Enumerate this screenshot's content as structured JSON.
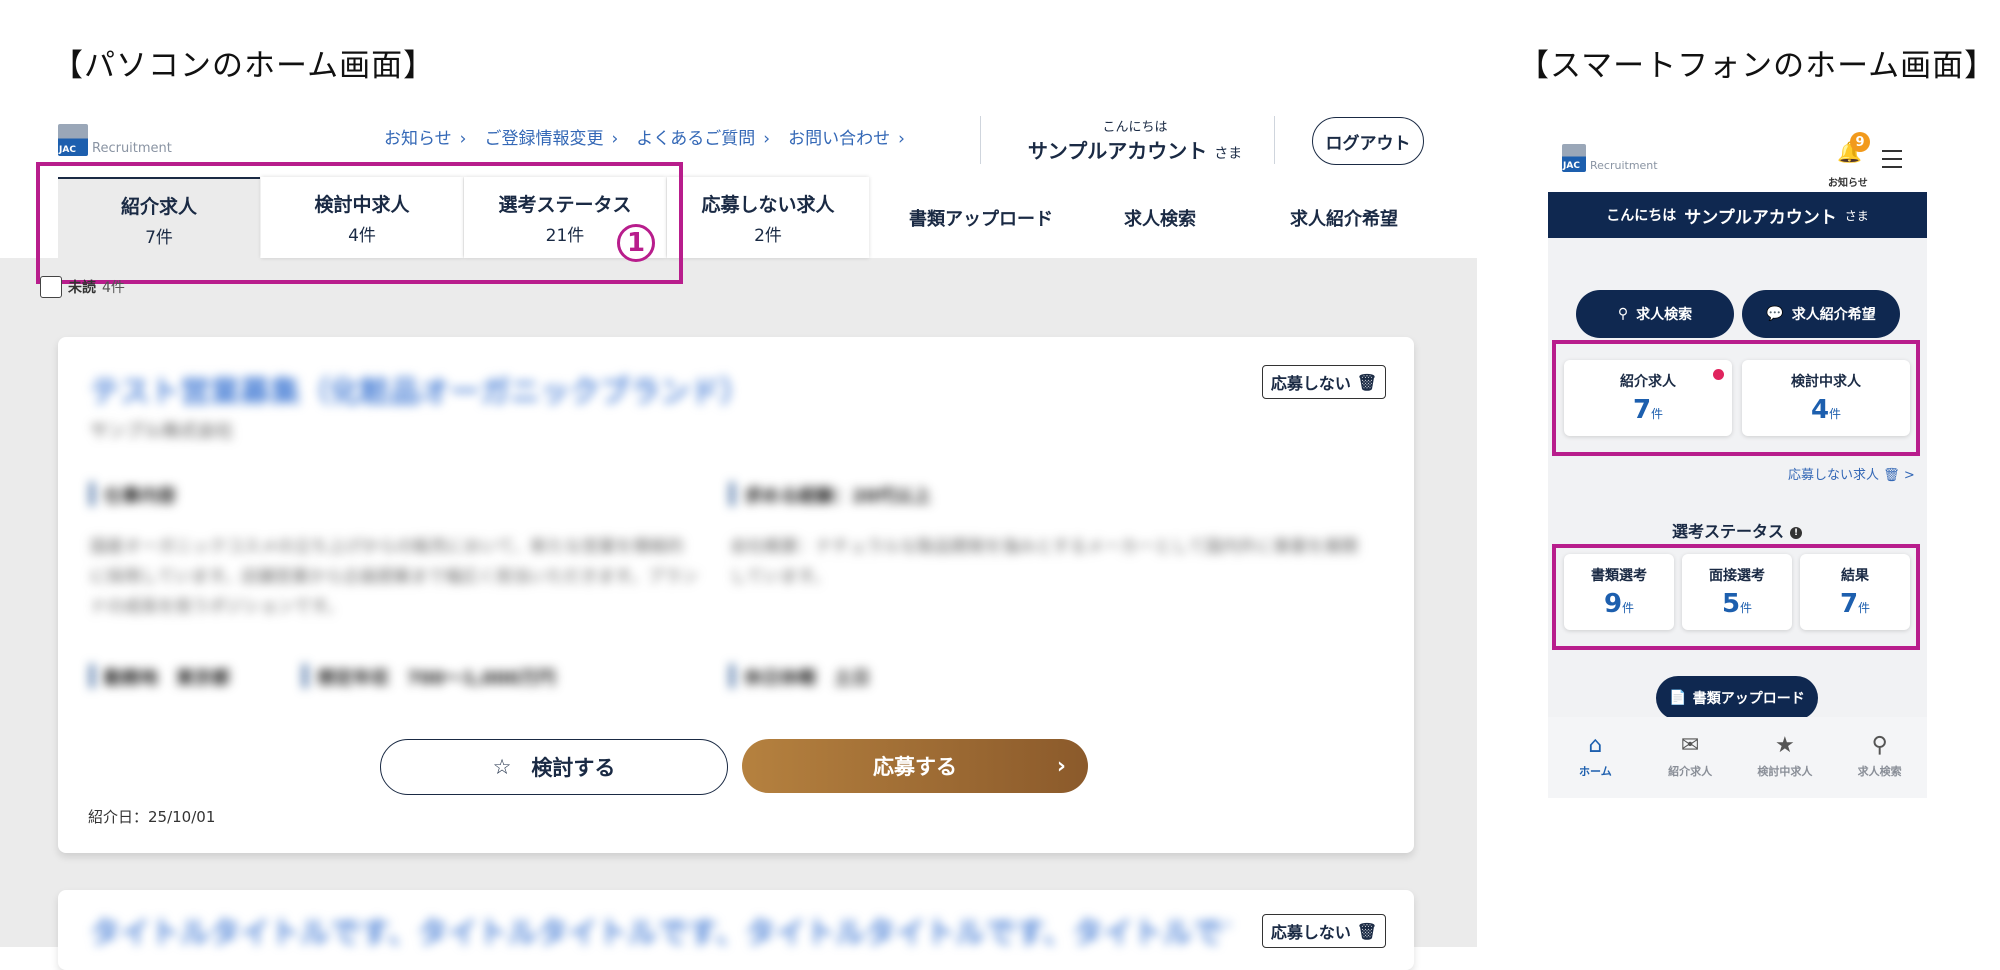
{
  "titles": {
    "pc": "【パソコンのホーム画面】",
    "sp": "【スマートフォンのホーム画面】"
  },
  "colors": {
    "navy": "#0f2850",
    "accent_blue": "#1d5fae",
    "highlight": "#b81d8c",
    "apply_gradient_start": "#b5813f",
    "apply_gradient_end": "#8b5a2b",
    "badge": "#f29a1c",
    "unread_dot": "#e0245e"
  },
  "brand": {
    "logo_text": "Recruitment"
  },
  "pc": {
    "top_links": [
      {
        "label": "お知らせ",
        "chevron": "›"
      },
      {
        "label": "ご登録情報変更",
        "chevron": "›"
      },
      {
        "label": "よくあるご質問",
        "chevron": "›"
      },
      {
        "label": "お問い合わせ",
        "chevron": "›"
      }
    ],
    "greeting": {
      "hello": "こんにちは",
      "name": "サンプルアカウント",
      "honorific": "さま"
    },
    "logout": "ログアウト",
    "tabs": [
      {
        "label": "紹介求人",
        "count": "7件"
      },
      {
        "label": "検討中求人",
        "count": "4件"
      },
      {
        "label": "選考ステータス",
        "count": "21件"
      },
      {
        "label": "応募しない求人",
        "count": "2件"
      }
    ],
    "plain_tabs": [
      "書類アップロード",
      "求人検索",
      "求人紹介希望"
    ],
    "marker": "1",
    "unread": {
      "label": "未読",
      "count": "4件"
    },
    "card1": {
      "title": "テスト営業募集（化粧品オーガニックブランド）",
      "company": "サンプル株式会社",
      "field1_label": "仕事内容",
      "field2_label": "求める経験：20代以上",
      "body_left": "国産オーガニックコスメの立ち上げからの販売において、新たな営業を積極的に採用しています。店舗営業から企画提案まで幅広く担当いただきます。ブランドの成長を担うポジションです。",
      "body_right": "会社概要：ナチュラルな製品開発を強みとするメーカーとして国内外に事業を展開しています。",
      "meta1": "勤務地　東京都",
      "meta2": "想定年収　700〜1,000万円",
      "meta3": "休日休暇　土日",
      "decline": "応募しない",
      "consider": "検討する",
      "apply": "応募する",
      "apply_chevron": "›",
      "intro_date": "紹介日：25/10/01"
    },
    "card2": {
      "title": "タイトルタイトルです、タイトルタイトルです、タイトルタイトルです、タイトルです、…",
      "decline": "応募しない"
    }
  },
  "sp": {
    "notice_badge": "9",
    "notice_label": "お知らせ",
    "greeting": {
      "hello": "こんにちは",
      "name": "サンプルアカウント",
      "honorific": "さま"
    },
    "pills": [
      "求人検索",
      "求人紹介希望"
    ],
    "top_cards": [
      {
        "label": "紹介求人",
        "num": "7",
        "unit": "件"
      },
      {
        "label": "検討中求人",
        "num": "4",
        "unit": "件"
      }
    ],
    "decline_link": "応募しない求人",
    "decline_chevron": ">",
    "status_title": "選考ステータス",
    "status_cards": [
      {
        "label": "書類選考",
        "num": "9",
        "unit": "件"
      },
      {
        "label": "面接選考",
        "num": "5",
        "unit": "件"
      },
      {
        "label": "結果",
        "num": "7",
        "unit": "件"
      }
    ],
    "upload": "書類アップロード",
    "bottom_nav": [
      {
        "label": "ホーム",
        "icon": "home-icon",
        "glyph": "⌂"
      },
      {
        "label": "紹介求人",
        "icon": "mail-icon",
        "glyph": "✉"
      },
      {
        "label": "検討中求人",
        "icon": "star-icon",
        "glyph": "★"
      },
      {
        "label": "求人検索",
        "icon": "search-icon",
        "glyph": "⚲"
      }
    ]
  }
}
